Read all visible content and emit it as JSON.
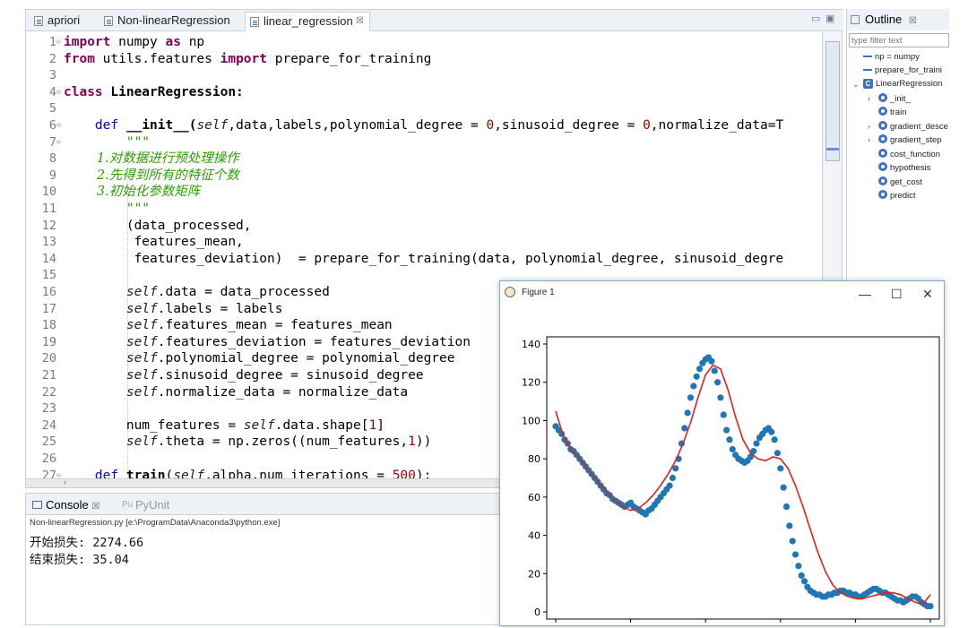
{
  "editor": {
    "tabs": [
      {
        "label": "apriori"
      },
      {
        "label": "Non-linearRegression"
      },
      {
        "label": "linear_regression",
        "close": "☒"
      }
    ],
    "minimize": "▭",
    "maximize": "▣"
  },
  "code": {
    "lines": [
      {
        "n": "1",
        "mark": "⊖"
      },
      {
        "n": "2"
      },
      {
        "n": "3"
      },
      {
        "n": "4",
        "mark": "⊖"
      },
      {
        "n": "5"
      },
      {
        "n": "6",
        "mark": "⊖"
      },
      {
        "n": "7",
        "mark": "⊖"
      },
      {
        "n": "8"
      },
      {
        "n": "9"
      },
      {
        "n": "10"
      },
      {
        "n": "11"
      },
      {
        "n": "12"
      },
      {
        "n": "13"
      },
      {
        "n": "14"
      },
      {
        "n": "15"
      },
      {
        "n": "16"
      },
      {
        "n": "17"
      },
      {
        "n": "18"
      },
      {
        "n": "19"
      },
      {
        "n": "20"
      },
      {
        "n": "21"
      },
      {
        "n": "22"
      },
      {
        "n": "23"
      },
      {
        "n": "24"
      },
      {
        "n": "25"
      },
      {
        "n": "26"
      },
      {
        "n": "27",
        "mark": "⊖"
      }
    ],
    "t": {
      "l1": [
        "import",
        " numpy ",
        "as",
        " np"
      ],
      "l2": [
        "from",
        " utils.features ",
        "import",
        " prepare_for_training"
      ],
      "l4": [
        "class",
        " LinearRegression:"
      ],
      "l6": [
        "    ",
        "def",
        " __init__(",
        "self",
        ",data,labels,polynomial_degree = ",
        "0",
        ",sinusoid_degree = ",
        "0",
        ",normalize_data=T"
      ],
      "l7": "        \"\"\"",
      "l8": "        1.对数据进行预处理操作",
      "l9": "        2.先得到所有的特征个数",
      "l10": "        3.初始化参数矩阵",
      "l11": "        \"\"\"",
      "l12": "        (data_processed,",
      "l13": "         features_mean,",
      "l14": "         features_deviation)  = prepare_for_training(data, polynomial_degree, sinusoid_degre",
      "l16": [
        "        ",
        "self",
        ".data = data_processed"
      ],
      "l17": [
        "        ",
        "self",
        ".labels = labels"
      ],
      "l18": [
        "        ",
        "self",
        ".features_mean = features_mean"
      ],
      "l19": [
        "        ",
        "self",
        ".features_deviation = features_deviation"
      ],
      "l20": [
        "        ",
        "self",
        ".polynomial_degree = polynomial_degree"
      ],
      "l21": [
        "        ",
        "self",
        ".sinusoid_degree = sinusoid_degree"
      ],
      "l22": [
        "        ",
        "self",
        ".normalize_data = normalize_data"
      ],
      "l24": [
        "        num_features = ",
        "self",
        ".data.shape[",
        "1",
        "]"
      ],
      "l25": [
        "        ",
        "self",
        ".theta = np.zeros((num_features,",
        "1",
        "))"
      ],
      "l27": [
        "    ",
        "def",
        " ",
        "train",
        "(",
        "self",
        ",alpha,num_iterations = ",
        "500",
        "):"
      ]
    }
  },
  "outline": {
    "title": "Outline",
    "close": "☒",
    "filter_placeholder": "type filter text",
    "items": [
      {
        "label": "np = numpy"
      },
      {
        "label": "prepare_for_traini"
      },
      {
        "label": "LinearRegression",
        "cls": "C"
      },
      {
        "label": "_init_"
      },
      {
        "label": "train"
      },
      {
        "label": "gradient_desce"
      },
      {
        "label": "gradient_step"
      },
      {
        "label": "cost_function"
      },
      {
        "label": "hypothesis"
      },
      {
        "label": "get_cost"
      },
      {
        "label": "predict"
      }
    ]
  },
  "console": {
    "tabs": [
      {
        "label": "Console",
        "close": "☒"
      },
      {
        "label": "PyUnit"
      }
    ],
    "path": "Non-linearRegression.py [e:\\ProgramData\\Anaconda3\\python.exe]",
    "lines": [
      "开始损失: 2274.66",
      "结束损失: 35.04"
    ]
  },
  "figure": {
    "title": "Figure 1",
    "controls": {
      "minimize": "—",
      "maximize": "☐",
      "close": "✕"
    }
  },
  "chart_data": {
    "type": "scatter",
    "xlim": [
      0,
      250
    ],
    "ylim": [
      0,
      140
    ],
    "xticks": [
      "0",
      "50",
      "100",
      "150",
      "200",
      "250"
    ],
    "yticks": [
      "0",
      "20",
      "40",
      "60",
      "80",
      "100",
      "120",
      "140"
    ],
    "colors": {
      "points": "#1f77b4",
      "fit": "#e02020"
    },
    "series": [
      {
        "kind": "points",
        "x": [
          0,
          2,
          4,
          6,
          8,
          10,
          12,
          14,
          16,
          18,
          20,
          22,
          24,
          26,
          28,
          30,
          32,
          34,
          36,
          38,
          40,
          42,
          44,
          46,
          48,
          50,
          52,
          54,
          56,
          58,
          60,
          62,
          64,
          66,
          68,
          70,
          72,
          74,
          76,
          78,
          80,
          82,
          84,
          86,
          88,
          90,
          92,
          94,
          96,
          98,
          100,
          102,
          104,
          106,
          108,
          110,
          112,
          114,
          116,
          118,
          120,
          122,
          124,
          126,
          128,
          130,
          132,
          134,
          136,
          138,
          140,
          142,
          144,
          146,
          148,
          150,
          152,
          154,
          156,
          158,
          160,
          162,
          164,
          166,
          168,
          170,
          172,
          174,
          176,
          178,
          180,
          182,
          184,
          186,
          188,
          190,
          192,
          194,
          196,
          198,
          200,
          202,
          204,
          206,
          208,
          210,
          212,
          214,
          216,
          218,
          220,
          222,
          224,
          226,
          228,
          230,
          232,
          234,
          236,
          238,
          240,
          242,
          244,
          246,
          248,
          250
        ],
        "y": [
          97,
          95,
          93,
          90,
          88,
          85,
          84,
          82,
          80,
          78,
          76,
          74,
          72,
          70,
          68,
          66,
          64,
          62,
          61,
          59,
          58,
          57,
          56,
          55,
          56,
          57,
          55,
          54,
          53,
          52,
          51,
          53,
          54,
          56,
          58,
          60,
          62,
          64,
          66,
          70,
          75,
          80,
          88,
          96,
          104,
          112,
          118,
          123,
          127,
          130,
          132,
          133,
          131,
          126,
          120,
          112,
          103,
          95,
          90,
          85,
          82,
          80,
          79,
          78,
          79,
          81,
          84,
          88,
          91,
          93,
          95,
          96,
          94,
          90,
          83,
          75,
          65,
          55,
          45,
          37,
          30,
          24,
          19,
          16,
          13,
          11,
          10,
          9,
          9,
          8,
          8,
          9,
          9,
          10,
          10,
          11,
          11,
          10,
          10,
          9,
          9,
          8,
          8,
          9,
          10,
          11,
          12,
          12,
          11,
          10,
          10,
          9,
          8,
          7,
          6,
          6,
          5,
          6,
          7,
          8,
          8,
          7,
          5,
          4,
          3,
          3
        ]
      },
      {
        "kind": "fit",
        "x": [
          0,
          5,
          10,
          15,
          20,
          25,
          30,
          35,
          40,
          45,
          50,
          55,
          60,
          65,
          70,
          75,
          80,
          85,
          90,
          95,
          100,
          105,
          110,
          115,
          120,
          125,
          130,
          135,
          140,
          145,
          150,
          155,
          160,
          165,
          170,
          175,
          180,
          185,
          190,
          195,
          200,
          205,
          210,
          215,
          220,
          225,
          230,
          235,
          240,
          245,
          250
        ],
        "y": [
          105,
          92,
          85,
          81,
          76,
          71,
          66,
          62,
          58,
          55,
          53,
          54,
          57,
          61,
          66,
          72,
          79,
          88,
          99,
          112,
          124,
          129,
          127,
          116,
          102,
          90,
          83,
          80,
          79,
          81,
          80,
          75,
          66,
          55,
          43,
          31,
          21,
          14,
          10,
          8,
          7,
          7,
          8,
          9,
          10,
          10,
          9,
          7,
          5,
          4,
          9
        ]
      }
    ]
  }
}
